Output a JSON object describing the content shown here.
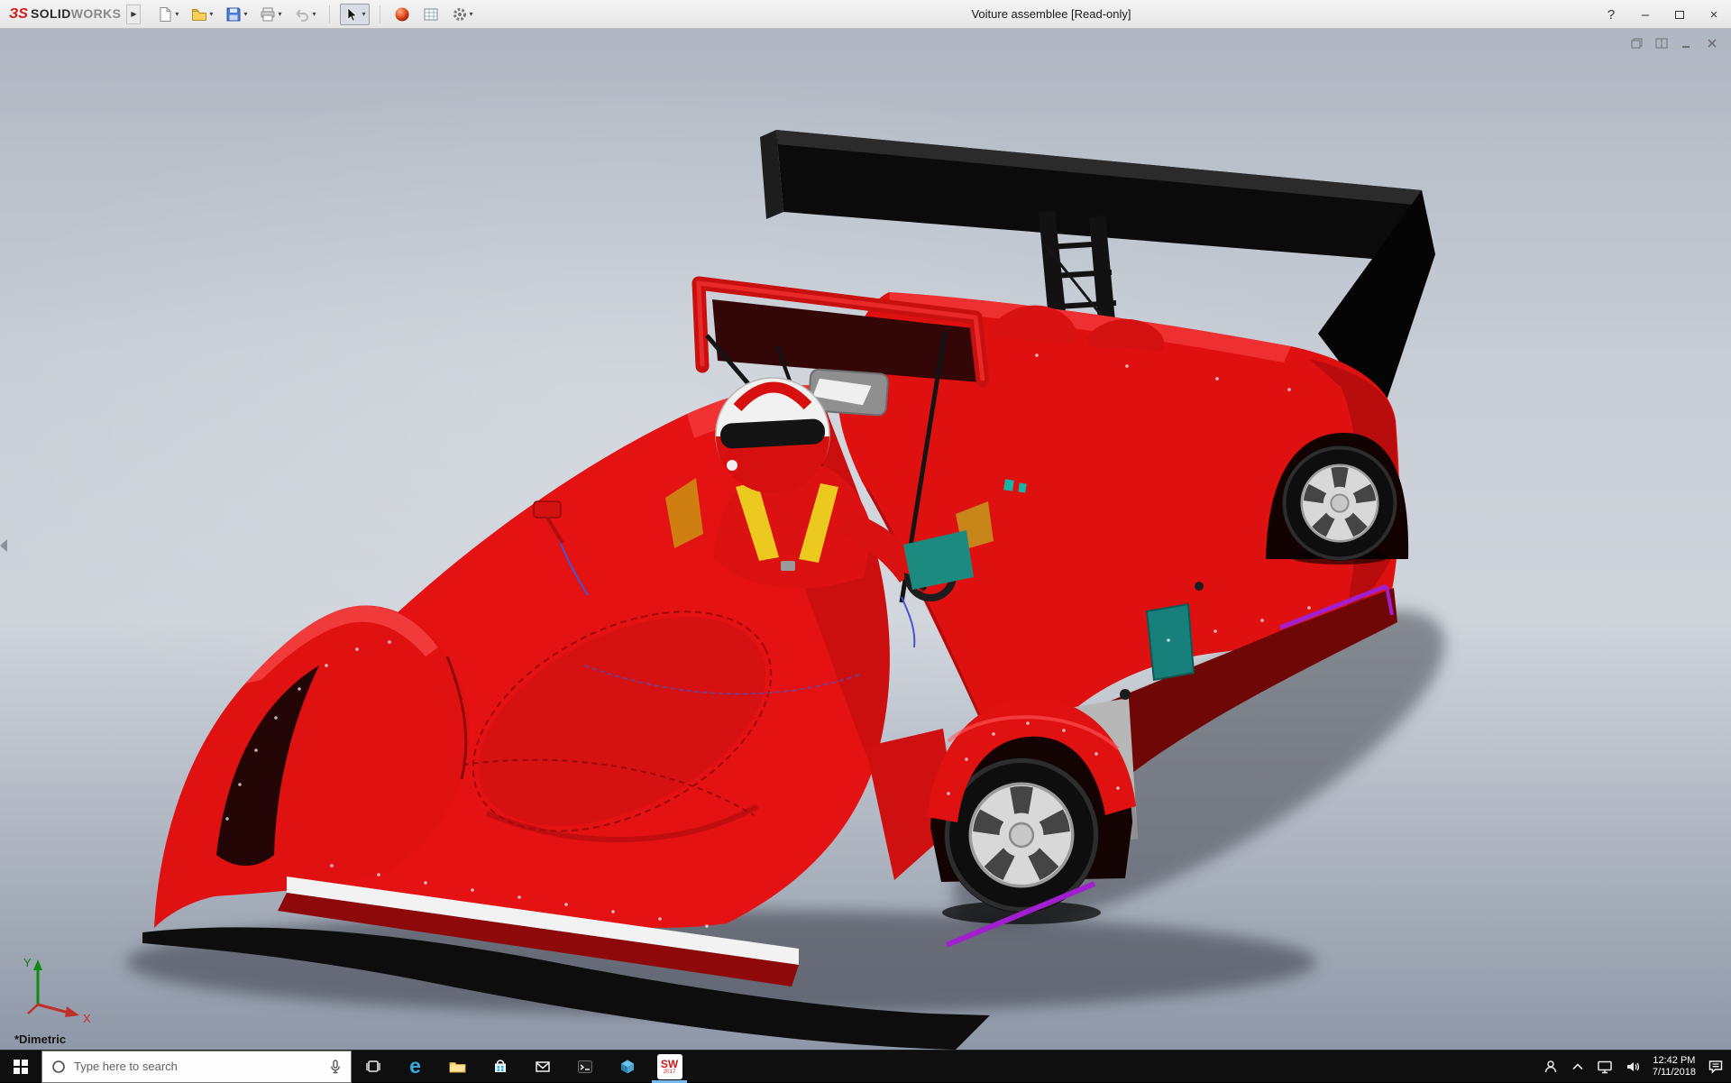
{
  "window": {
    "brand_mark": "ЗS",
    "brand_solid": "SOLID",
    "brand_works": "WORKS",
    "flyout_arrow": "▶",
    "title": "Voiture assemblee [Read-only]",
    "controls": {
      "help": "?",
      "minimize": "–",
      "close": "×"
    }
  },
  "toolbar": {
    "caret": "▾",
    "buttons": [
      "new-document",
      "open",
      "save",
      "print",
      "undo",
      "select",
      "edit-appearance",
      "design-table",
      "options"
    ]
  },
  "viewport": {
    "view_label": "*Dimetric",
    "triad": {
      "x_label": "X",
      "y_label": "Y"
    }
  },
  "taskbar": {
    "search_placeholder": "Type here to search",
    "edge_letter": "e",
    "solidworks_label": "SW",
    "solidworks_year": "2017",
    "clock_time": "12:42 PM",
    "clock_date": "7/11/2018"
  },
  "colors": {
    "body_red": "#e41212",
    "wing_black": "#0a0a0a",
    "rim_silver": "#d8d8d8",
    "harness_yellow": "#ecc91f",
    "accent_teal": "#1c8a7f",
    "accent_purple": "#a21fd0",
    "background_top": "#b0b7c2",
    "background_bottom": "#8f98a8",
    "taskbar_bg": "#0f0f0f",
    "titlebar_bg": "#ededed"
  }
}
